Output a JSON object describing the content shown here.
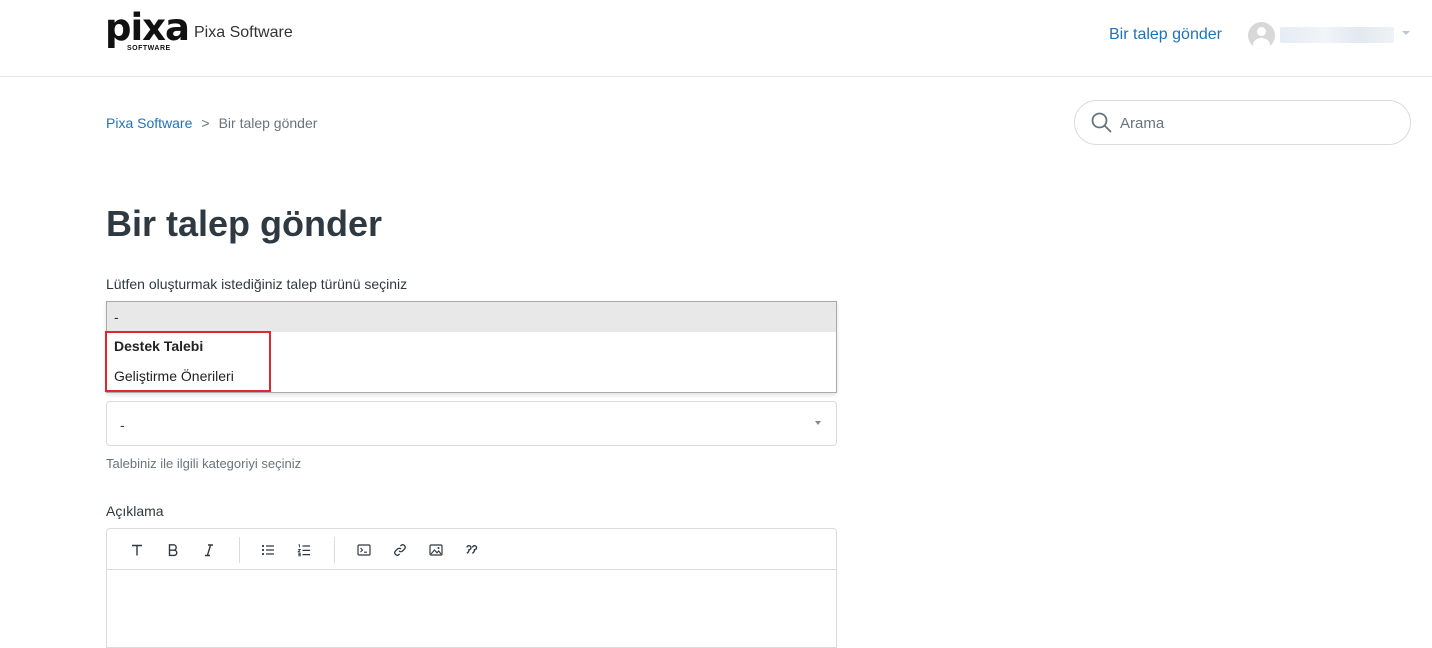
{
  "header": {
    "logo_text": "pixa",
    "logo_subtext": "SOFTWARE",
    "site_name": "Pixa Software",
    "submit_request_link": "Bir talep gönder"
  },
  "breadcrumb": {
    "items": [
      "Pixa Software",
      "Bir talep gönder"
    ],
    "separator": ">"
  },
  "search": {
    "placeholder": "Arama"
  },
  "page": {
    "title": "Bir talep gönder",
    "form_type_label": "Lütfen oluşturmak istediğiniz talep türünü seçiniz",
    "form_type_dropdown": {
      "selected": "-",
      "options": [
        "Destek Talebi",
        "Geliştirme Önerileri"
      ]
    },
    "category_select": {
      "value": "-",
      "hint": "Talebiniz ile ilgili kategoriyi seçiniz"
    },
    "description_label": "Açıklama"
  },
  "colors": {
    "link": "#1f73b7",
    "highlight_border": "#e0262e",
    "text": "#2f3941"
  },
  "toolbar_icons": [
    "text-size-icon",
    "bold-icon",
    "italic-icon",
    "bullet-list-icon",
    "numbered-list-icon",
    "code-block-icon",
    "link-icon",
    "image-icon",
    "quote-icon"
  ]
}
